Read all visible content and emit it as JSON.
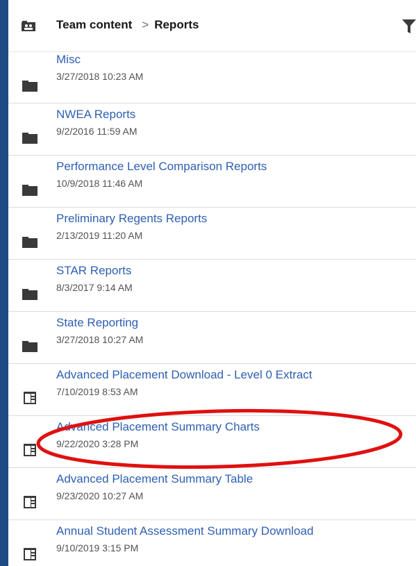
{
  "header": {
    "breadcrumb_root": "Team content",
    "breadcrumb_separator": ">",
    "breadcrumb_current": "Reports"
  },
  "items": [
    {
      "name": "Misc",
      "date": "3/27/2018 10:23 AM",
      "type": "folder"
    },
    {
      "name": "NWEA Reports",
      "date": "9/2/2016 11:59 AM",
      "type": "folder"
    },
    {
      "name": "Performance Level Comparison Reports",
      "date": "10/9/2018 11:46 AM",
      "type": "folder"
    },
    {
      "name": "Preliminary Regents Reports",
      "date": "2/13/2019 11:20 AM",
      "type": "folder"
    },
    {
      "name": "STAR Reports",
      "date": "8/3/2017 9:14 AM",
      "type": "folder"
    },
    {
      "name": "State Reporting",
      "date": "3/27/2018 10:27 AM",
      "type": "folder"
    },
    {
      "name": "Advanced Placement Download - Level 0 Extract",
      "date": "7/10/2019 8:53 AM",
      "type": "report"
    },
    {
      "name": "Advanced Placement Summary Charts",
      "date": "9/22/2020 3:28 PM",
      "type": "report"
    },
    {
      "name": "Advanced Placement Summary Table",
      "date": "9/23/2020 10:27 AM",
      "type": "report"
    },
    {
      "name": "Annual Student Assessment Summary Download",
      "date": "9/10/2019 3:15 PM",
      "type": "report"
    }
  ],
  "colors": {
    "background": "#1d4c84",
    "link": "#2d5fb3",
    "annotation": "#e01010"
  },
  "icons": {
    "folder": "folder-icon",
    "report": "report-icon",
    "team": "team-content-icon",
    "filter": "filter-icon"
  }
}
